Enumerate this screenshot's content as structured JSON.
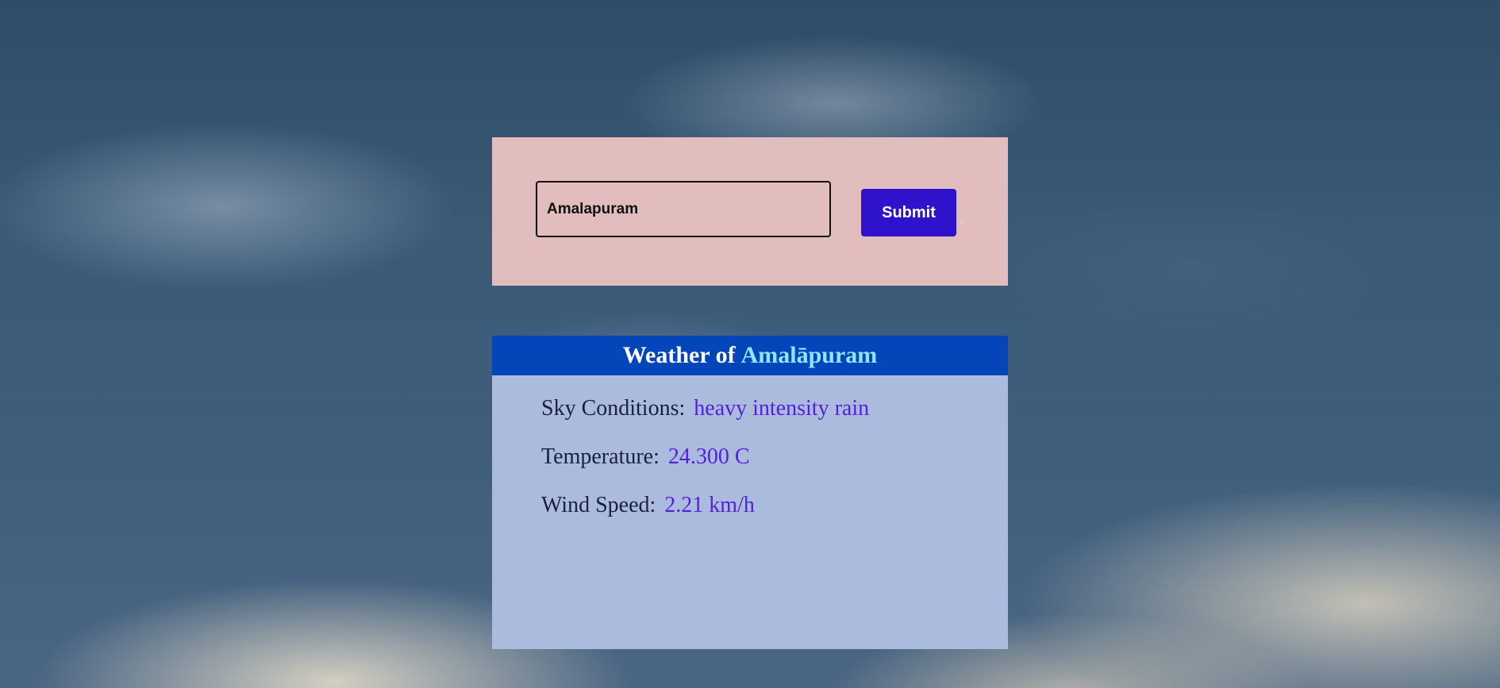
{
  "search": {
    "value": "Amalapuram",
    "submit_label": "Submit",
    "trailing_mark": "."
  },
  "weather": {
    "title_prefix": "Weather of",
    "city": "Amalāpuram",
    "sky_label": "Sky Conditions:",
    "sky_value": "heavy intensity rain",
    "temp_label": "Temperature:",
    "temp_value": "24.300 C",
    "wind_label": "Wind Speed:",
    "wind_value": "2.21 km/h"
  },
  "colors": {
    "search_panel_bg": "#e1bdbd",
    "submit_button_bg": "#2f12cc",
    "card_header_bg": "#0446ba",
    "card_body_bg": "#abbbdd",
    "city_highlight": "#8ee6ff",
    "value_text": "#5420e0"
  }
}
